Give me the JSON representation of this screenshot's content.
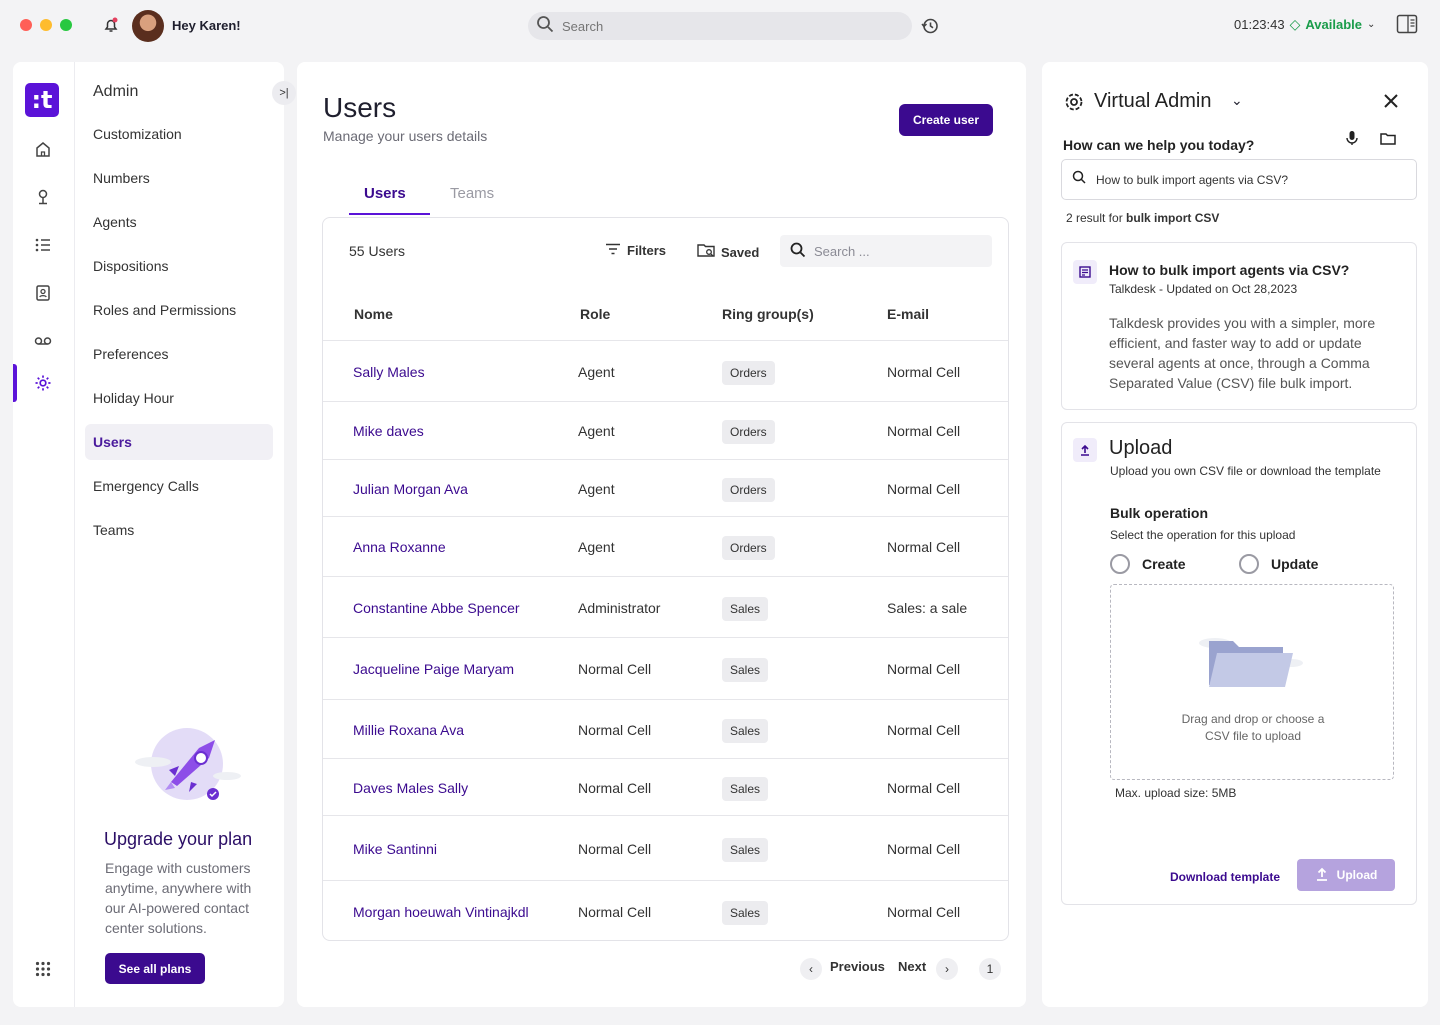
{
  "topbar": {
    "greeting": "Hey Karen!",
    "search_placeholder": "Search",
    "timer": "01:23:43",
    "status": "Available"
  },
  "colors": {
    "brand": "#5b13d8",
    "brand_dark": "#3b0a8f",
    "available": "#1a9c4a"
  },
  "nav": {
    "title": "Admin",
    "items": [
      "Customization",
      "Numbers",
      "Agents",
      "Dispositions",
      "Roles and Permissions",
      "Preferences",
      "Holiday Hour",
      "Users",
      "Emergency Calls",
      "Teams"
    ],
    "active": "Users"
  },
  "upgrade": {
    "title": "Upgrade your plan",
    "text": "Engage with customers anytime, anywhere with our AI-powered contact center solutions.",
    "button": "See all plans"
  },
  "main": {
    "title": "Users",
    "subtitle": "Manage your users details",
    "create_button": "Create user",
    "tabs": [
      "Users",
      "Teams"
    ]
  },
  "table": {
    "count": "55 Users",
    "filters": "Filters",
    "saved": "Saved",
    "search_placeholder": "Search ...",
    "headers": [
      "Nome",
      "Role",
      "Ring group(s)",
      "E-mail"
    ],
    "rows": [
      {
        "name": "Sally Males",
        "role": "Agent",
        "group": "Orders",
        "email": "Normal Cell"
      },
      {
        "name": "Mike daves",
        "role": "Agent",
        "group": "Orders",
        "email": "Normal Cell"
      },
      {
        "name": "Julian Morgan Ava",
        "role": "Agent",
        "group": "Orders",
        "email": "Normal Cell"
      },
      {
        "name": "Anna Roxanne",
        "role": "Agent",
        "group": "Orders",
        "email": "Normal Cell"
      },
      {
        "name": "Constantine Abbe Spencer",
        "role": "Administrator",
        "group": "Sales",
        "email": "Sales: a sale"
      },
      {
        "name": "Jacqueline Paige Maryam",
        "role": "Normal Cell",
        "group": "Sales",
        "email": "Normal Cell"
      },
      {
        "name": "Millie Roxana Ava",
        "role": "Normal Cell",
        "group": "Sales",
        "email": "Normal Cell"
      },
      {
        "name": "Daves Males Sally",
        "role": "Normal Cell",
        "group": "Sales",
        "email": "Normal Cell"
      },
      {
        "name": "Mike Santinni",
        "role": "Normal Cell",
        "group": "Sales",
        "email": "Normal Cell"
      },
      {
        "name": "Morgan hoeuwah Vintinajkdl",
        "role": "Normal Cell",
        "group": "Sales",
        "email": "Normal Cell"
      }
    ]
  },
  "pagination": {
    "previous": "Previous",
    "next": "Next",
    "page": "1"
  },
  "assistant": {
    "title": "Virtual Admin",
    "question": "How can we help you today?",
    "query": "How to bulk import agents via CSV?",
    "result_prefix": "2 result for ",
    "result_term": "bulk import CSV",
    "article": {
      "title": "How to bulk import agents via CSV?",
      "meta": "Talkdesk - Updated on Oct 28,2023",
      "body": "Talkdesk provides you with a simpler, more efficient, and faster way to add or update several agents at once, through a Comma Separated Value (CSV) file bulk import."
    },
    "upload": {
      "title": "Upload",
      "subtitle": "Upload you own CSV file or download the template",
      "bulk_title": "Bulk operation",
      "bulk_sub": "Select the operation for this upload",
      "opt_create": "Create",
      "opt_update": "Update",
      "drop_text": "Drag and drop or choose a CSV file to upload",
      "max_size": "Max. upload size: 5MB",
      "download": "Download template",
      "button": "Upload"
    }
  }
}
